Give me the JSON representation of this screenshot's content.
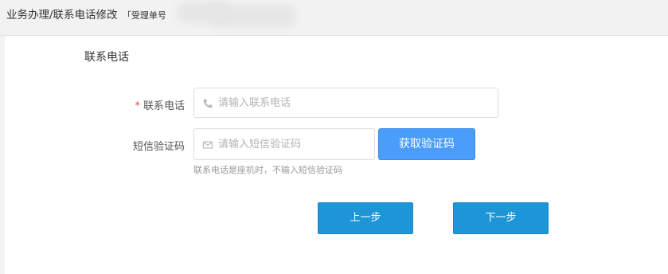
{
  "breadcrumb": {
    "path": "业务办理/联系电话修改",
    "ticket_prefix": "「受理单号"
  },
  "form": {
    "section_title": "联系电话",
    "phone": {
      "required_mark": "*",
      "label": "联系电话",
      "placeholder": "请输入联系电话",
      "icon": "phone-icon"
    },
    "sms_code": {
      "label": "短信验证码",
      "placeholder": "请输入短信验证码",
      "icon": "mail-icon",
      "get_code_label": "获取验证码",
      "hint": "联系电话是座机时，不输入短信验证码"
    }
  },
  "actions": {
    "prev_label": "上一步",
    "next_label": "下一步"
  },
  "colors": {
    "primary_button": "#1e95d6",
    "code_button": "#4a9df8",
    "required": "#e04b4b"
  }
}
